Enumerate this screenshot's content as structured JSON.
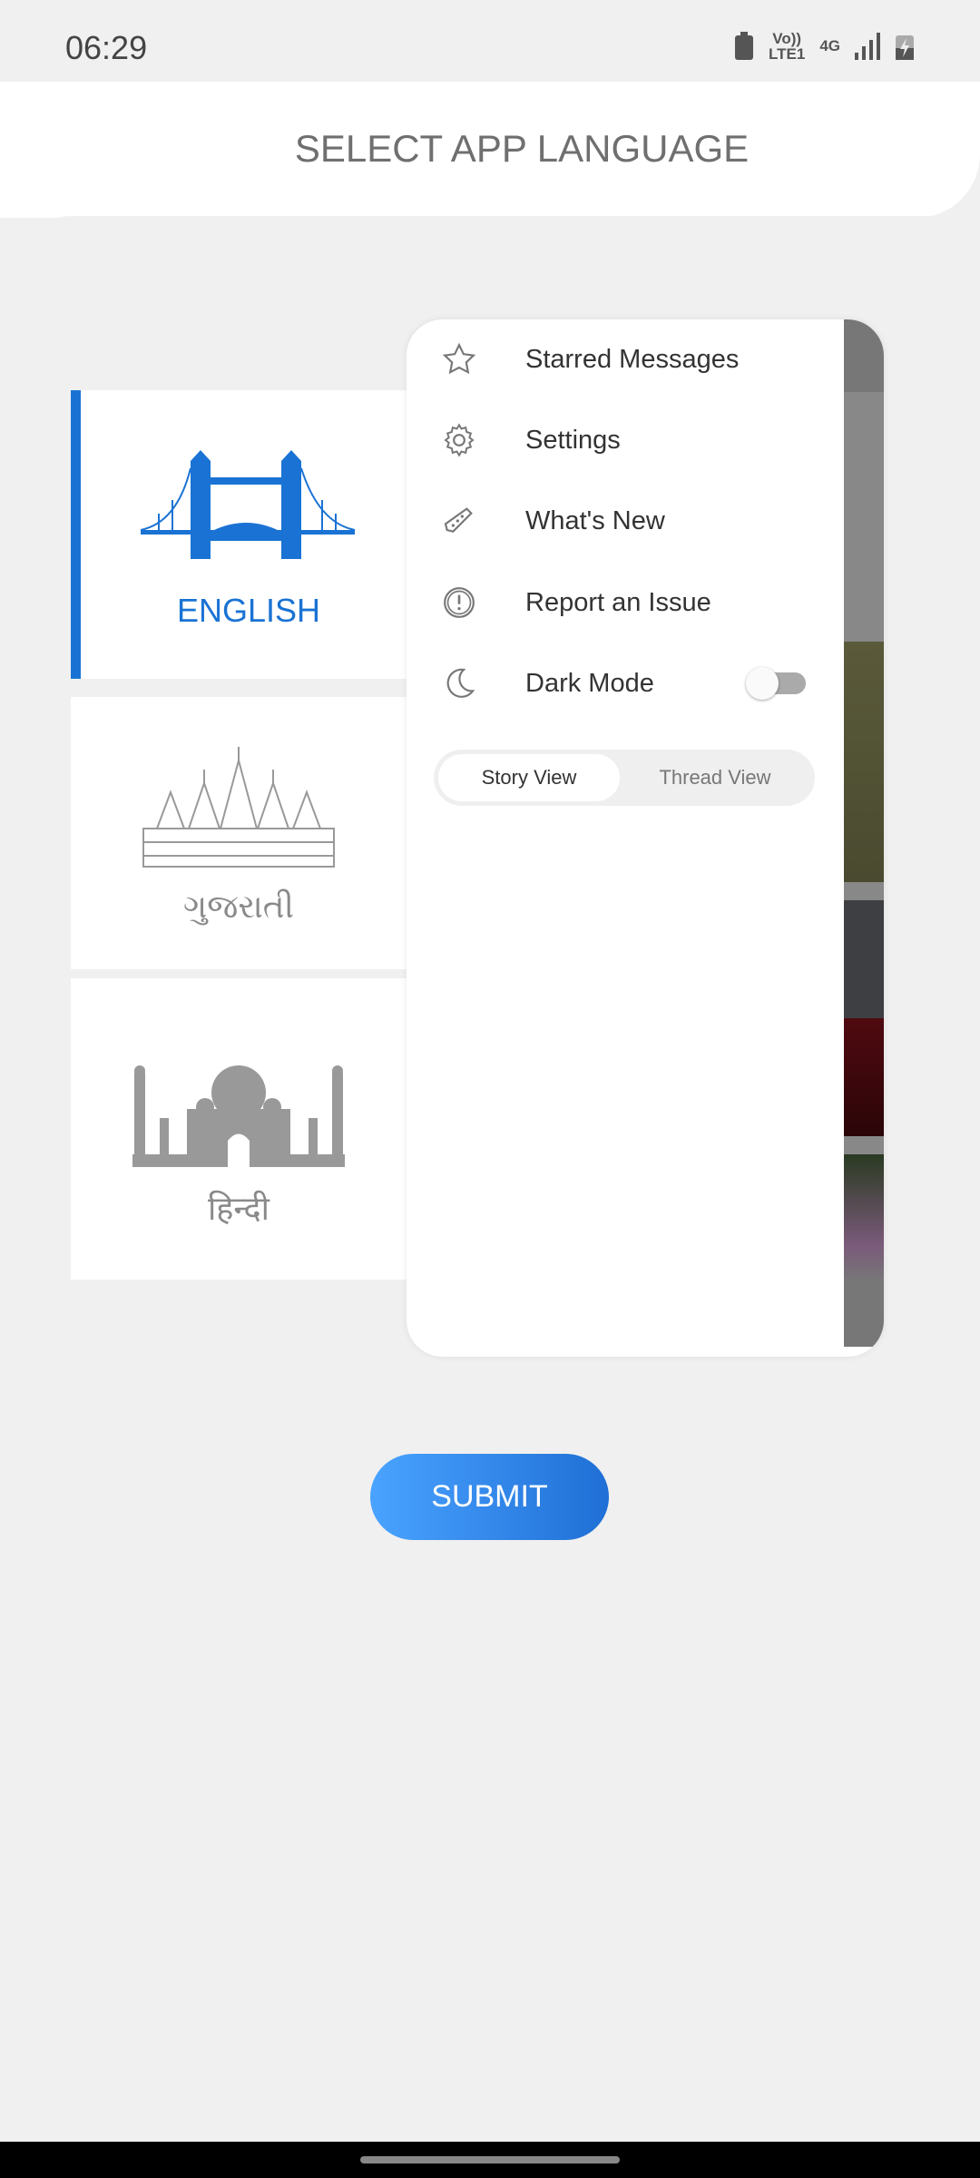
{
  "status_bar": {
    "time": "06:29",
    "network": "4G",
    "volte": "Vo))",
    "lte": "LTE1"
  },
  "header": {
    "title": "SELECT APP LANGUAGE"
  },
  "languages": [
    {
      "label": "ENGLISH",
      "selected": true,
      "icon": "tower-bridge-icon",
      "color": "#1a73d4"
    },
    {
      "label": "ગુજરાતી",
      "selected": false,
      "icon": "temple-icon",
      "color": "#8a8a8a"
    },
    {
      "label": "हिन्दी",
      "selected": false,
      "icon": "taj-mahal-icon",
      "color": "#8a8a8a"
    }
  ],
  "drawer": {
    "items": [
      {
        "label": "Starred Messages",
        "icon": "star-icon"
      },
      {
        "label": "Settings",
        "icon": "gear-icon"
      },
      {
        "label": "What's New",
        "icon": "tag-icon"
      },
      {
        "label": "Report an Issue",
        "icon": "alert-circle-icon"
      },
      {
        "label": "Dark Mode",
        "icon": "moon-icon",
        "toggle": false
      }
    ],
    "view_toggle": {
      "options": [
        "Story View",
        "Thread View"
      ],
      "selected": "Story View"
    }
  },
  "submit_label": "SUBMIT",
  "colors": {
    "accent": "#1a73d4",
    "button_start": "#4aa3ff",
    "button_end": "#1f6fd6"
  }
}
